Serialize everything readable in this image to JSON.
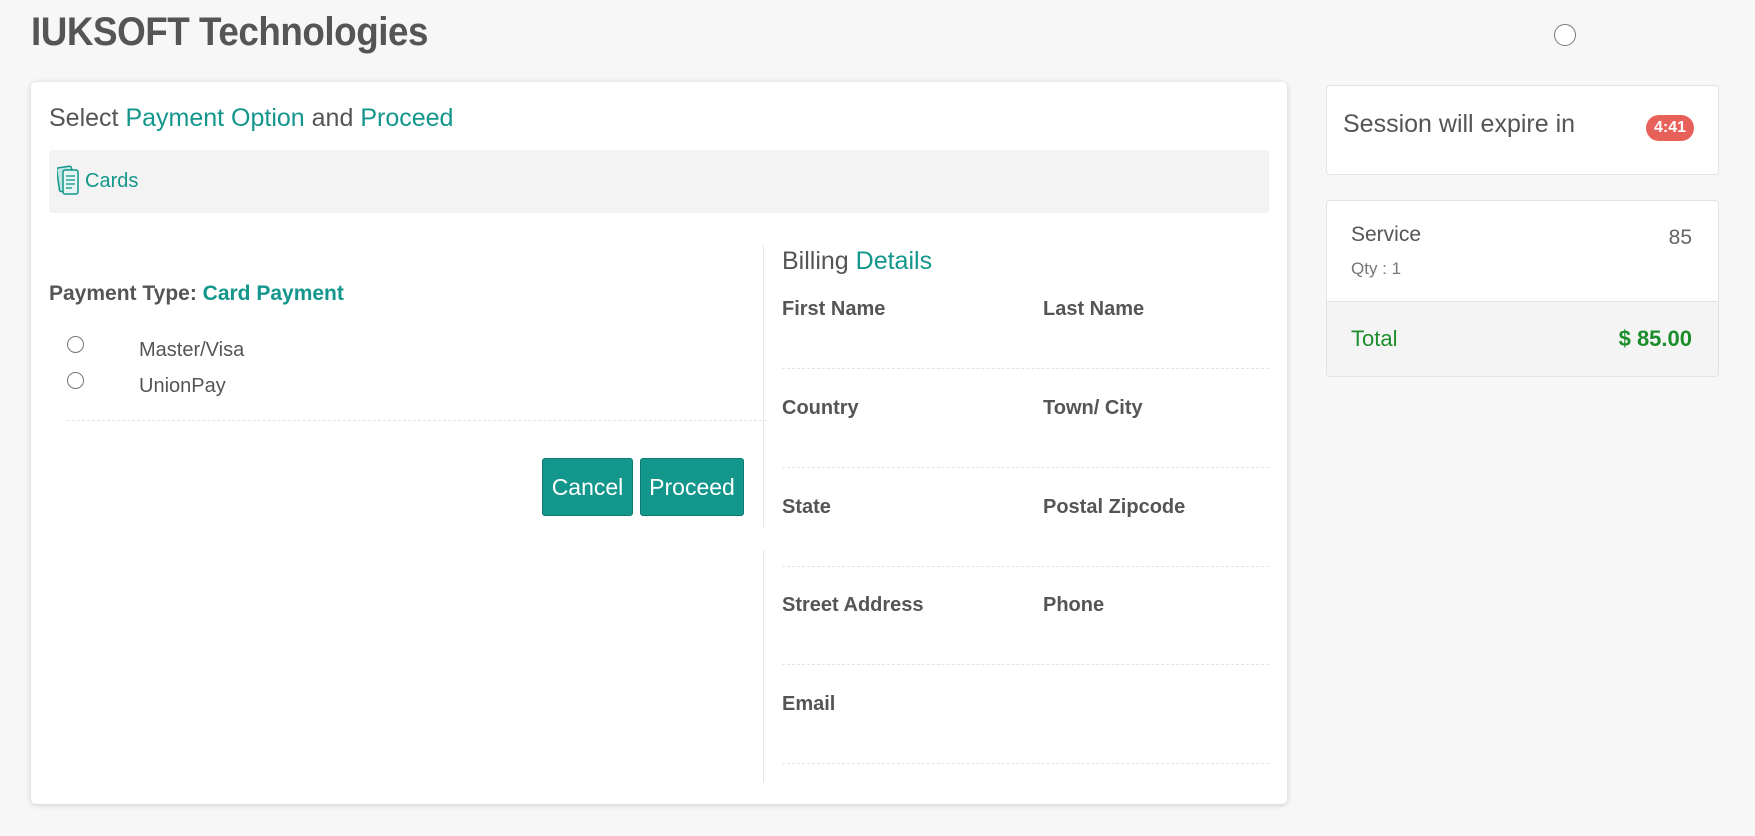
{
  "header": {
    "brand": "IUKSOFT Technologies"
  },
  "payment_panel": {
    "heading_prefix": "Select ",
    "heading_accent1": "Payment Option",
    "heading_middle": " and ",
    "heading_accent2": "Proceed",
    "tabs": [
      {
        "label": "Cards",
        "icon": "cards-icon"
      }
    ],
    "payment_type_label": "Payment Type: ",
    "payment_type_value": "Card Payment",
    "options": [
      {
        "label": "Master/Visa",
        "selected": false
      },
      {
        "label": "UnionPay",
        "selected": false
      }
    ],
    "cancel_label": "Cancel",
    "proceed_label": "Proceed"
  },
  "billing": {
    "title_prefix": "Billing ",
    "title_accent": "Details",
    "fields": {
      "first_name": "First Name",
      "last_name": "Last Name",
      "country": "Country",
      "town_city": "Town/ City",
      "state": "State",
      "postal_zipcode": "Postal Zipcode",
      "street_address": "Street Address",
      "phone": "Phone",
      "email": "Email"
    }
  },
  "session": {
    "text": "Session will expire in",
    "timer": "4:41"
  },
  "summary": {
    "service_name": "Service",
    "qty": "Qty : 1",
    "amount": "85",
    "total_label": "Total",
    "total_value": "$ 85.00"
  },
  "colors": {
    "accent": "#13968b",
    "total_green": "#1b8e2b",
    "badge_red": "#e8605a",
    "background": "#f7f7f7"
  }
}
